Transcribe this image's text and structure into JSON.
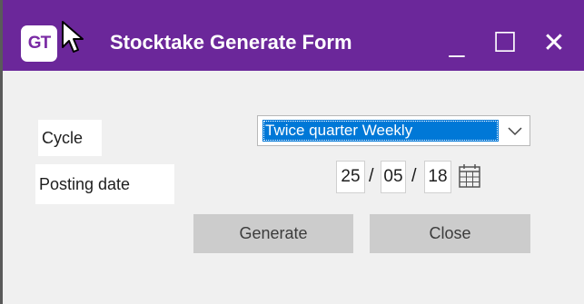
{
  "window": {
    "title": "Stocktake Generate Form",
    "logo_text": "GT",
    "controls": {
      "minimize": "_",
      "maximize": "☐",
      "close": "✕"
    },
    "colors": {
      "titlebar": "#6b279a",
      "body": "#f0f0f0",
      "selection": "#0078d7",
      "button": "#cccccc"
    }
  },
  "form": {
    "cycle_label": "Cycle",
    "cycle_value": "Twice quarter Weekly",
    "posting_date_label": "Posting date",
    "posting_date": {
      "day": "25",
      "month": "05",
      "year": "18",
      "separator": "/"
    }
  },
  "buttons": {
    "generate": "Generate",
    "close": "Close"
  },
  "icons": {
    "logo": "gt-logo",
    "cursor": "mouse-pointer-icon",
    "dropdown": "chevron-down-icon",
    "calendar": "calendar-icon"
  }
}
